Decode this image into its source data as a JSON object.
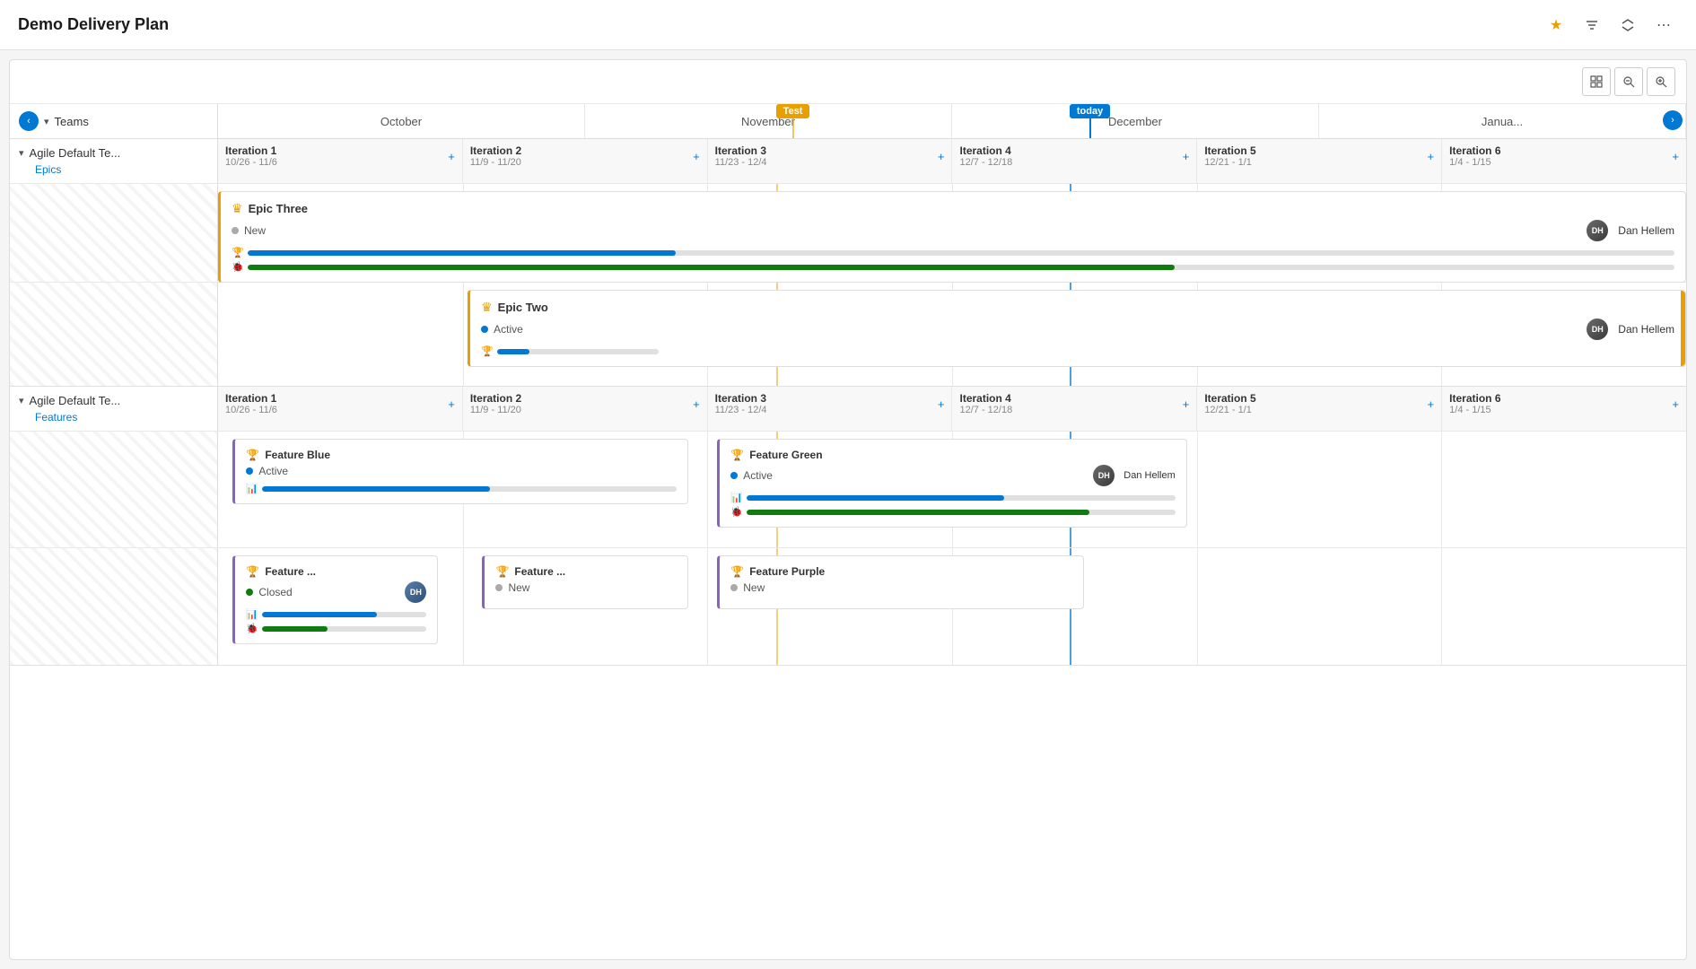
{
  "app": {
    "title": "Demo Delivery Plan"
  },
  "toolbar": {
    "zoom_out": "−",
    "zoom_in": "+",
    "layout_icon": "⊞",
    "star_icon": "★",
    "filter_icon": "⧖",
    "collapse_icon": "⤢",
    "more_icon": "⋯"
  },
  "header": {
    "teams_label": "Teams",
    "months": [
      "October",
      "November",
      "December",
      "Janua..."
    ],
    "milestones": [
      {
        "label": "Test",
        "color": "#e8a000",
        "position": 38
      },
      {
        "label": "today",
        "color": "#0078d4",
        "position": 55
      }
    ]
  },
  "teams": [
    {
      "name": "Agile Default Te...",
      "link": "Epics",
      "iterations": [
        {
          "name": "Iteration 1",
          "dates": "10/26 - 11/6"
        },
        {
          "name": "Iteration 2",
          "dates": "11/9 - 11/20"
        },
        {
          "name": "Iteration 3",
          "dates": "11/23 - 12/4"
        },
        {
          "name": "Iteration 4",
          "dates": "12/7 - 12/18"
        },
        {
          "name": "Iteration 5",
          "dates": "12/21 - 1/1"
        },
        {
          "name": "Iteration 6",
          "dates": "1/4 - 1/15"
        }
      ],
      "epics": [
        {
          "title": "Epic Three",
          "status": "New",
          "status_type": "new",
          "assignee": "Dan Hellem",
          "progress1": 30,
          "progress2": 65,
          "border_color": "#e8a000"
        },
        {
          "title": "Epic Two",
          "status": "Active",
          "status_type": "active",
          "assignee": "Dan Hellem",
          "progress1": 20,
          "border_color": "#e8a000",
          "overflow": true
        }
      ]
    },
    {
      "name": "Agile Default Te...",
      "link": "Features",
      "iterations": [
        {
          "name": "Iteration 1",
          "dates": "10/26 - 11/6"
        },
        {
          "name": "Iteration 2",
          "dates": "11/9 - 11/20"
        },
        {
          "name": "Iteration 3",
          "dates": "11/23 - 12/4"
        },
        {
          "name": "Iteration 4",
          "dates": "12/7 - 12/18"
        },
        {
          "name": "Iteration 5",
          "dates": "12/21 - 1/1"
        },
        {
          "name": "Iteration 6",
          "dates": "1/4 - 1/15"
        }
      ],
      "features_row1": [
        {
          "id": "fb",
          "title": "Feature Blue",
          "status": "Active",
          "status_type": "active",
          "assignee": null,
          "progress1": 55,
          "progress2": null,
          "border_color": "#8764b8",
          "col_start": 1,
          "truncated": false
        },
        {
          "id": "fg",
          "title": "Feature Green",
          "status": "Active",
          "status_type": "active",
          "assignee": "Dan Hellem",
          "progress1": 60,
          "progress2": 80,
          "border_color": "#8764b8",
          "col_start": 2,
          "truncated": false
        }
      ],
      "features_row2": [
        {
          "id": "fb2",
          "title": "Feature ...",
          "status": "Closed",
          "status_type": "closed",
          "assignee_avatar": true,
          "progress1": 70,
          "progress2": 40,
          "border_color": "#8764b8",
          "col_start": 1,
          "truncated": true
        },
        {
          "id": "fb3",
          "title": "Feature ...",
          "status": "New",
          "status_type": "new",
          "assignee": null,
          "progress1": null,
          "border_color": "#8764b8",
          "col_start": 2,
          "truncated": true
        },
        {
          "id": "fp",
          "title": "Feature Purple",
          "status": "New",
          "status_type": "new",
          "assignee": null,
          "progress1": null,
          "border_color": "#8764b8",
          "col_start": 3,
          "truncated": false
        }
      ]
    }
  ]
}
